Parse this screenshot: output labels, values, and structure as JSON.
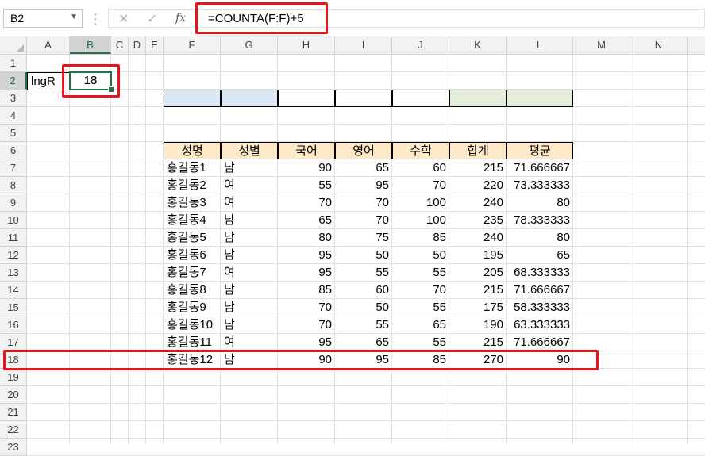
{
  "formula_bar": {
    "name_box": "B2",
    "formula": "=COUNTA(F:F)+5",
    "fx_label": "fx"
  },
  "columns": [
    "A",
    "B",
    "C",
    "D",
    "E",
    "F",
    "G",
    "H",
    "I",
    "J",
    "K",
    "L",
    "M",
    "N"
  ],
  "rows": [
    "1",
    "2",
    "3",
    "4",
    "5",
    "6",
    "7",
    "8",
    "9",
    "10",
    "11",
    "12",
    "13",
    "14",
    "15",
    "16",
    "17",
    "18",
    "19",
    "20",
    "21",
    "22",
    "23"
  ],
  "cells": {
    "a2": "lngR",
    "b2": "18"
  },
  "table": {
    "headers": [
      "성명",
      "성별",
      "국어",
      "영어",
      "수학",
      "합계",
      "평균"
    ],
    "rows": [
      [
        "홍길동1",
        "남",
        "90",
        "65",
        "60",
        "215",
        "71.666667"
      ],
      [
        "홍길동2",
        "여",
        "55",
        "95",
        "70",
        "220",
        "73.333333"
      ],
      [
        "홍길동3",
        "여",
        "70",
        "70",
        "100",
        "240",
        "80"
      ],
      [
        "홍길동4",
        "남",
        "65",
        "70",
        "100",
        "235",
        "78.333333"
      ],
      [
        "홍길동5",
        "남",
        "80",
        "75",
        "85",
        "240",
        "80"
      ],
      [
        "홍길동6",
        "남",
        "95",
        "50",
        "50",
        "195",
        "65"
      ],
      [
        "홍길동7",
        "여",
        "95",
        "55",
        "55",
        "205",
        "68.333333"
      ],
      [
        "홍길동8",
        "남",
        "85",
        "60",
        "70",
        "215",
        "71.666667"
      ],
      [
        "홍길동9",
        "남",
        "70",
        "50",
        "55",
        "175",
        "58.333333"
      ],
      [
        "홍길동10",
        "남",
        "70",
        "55",
        "65",
        "190",
        "63.333333"
      ],
      [
        "홍길동11",
        "여",
        "95",
        "65",
        "55",
        "215",
        "71.666667"
      ],
      [
        "홍길동12",
        "남",
        "90",
        "95",
        "85",
        "270",
        "90"
      ]
    ]
  },
  "colors": {
    "highlight": "#e8141b",
    "header_fill": "#fde9c8",
    "blue_fill": "#dbe8f6",
    "green_fill": "#e3efdb",
    "selection": "#217346"
  }
}
